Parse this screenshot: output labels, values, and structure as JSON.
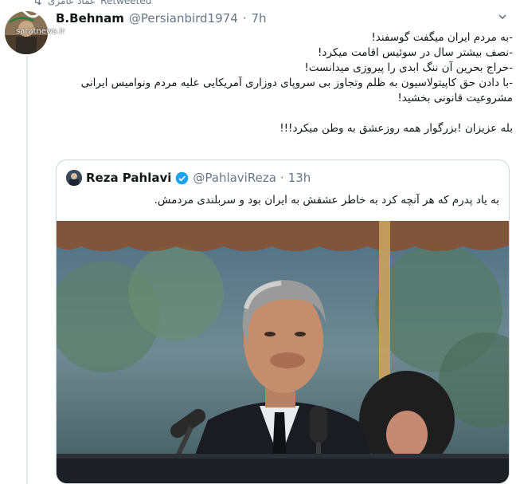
{
  "retweet": {
    "retweeter": "عماد عامری",
    "label": "Retweeted",
    "icon": "retweet-icon"
  },
  "watermark": {
    "site": "saratnews.ir"
  },
  "tweet": {
    "display_name": "B.Behnam",
    "handle": "@Persianbird1974",
    "dot": "·",
    "time": "7h",
    "lines": [
      "-به مردم ایران میگفت گوسفند!",
      "-نصف بیشتر سال در سوئیس اقامت میکرد!",
      "-حراج بحرین آن ننگ ابدی را پیروزی میدانست!",
      "-با دادن حق کاپیتولاسیون به ظلم وتجاوز بی سروپای دوزاری آمریکایی علیه مردم ونوامیس ایرانی",
      "مشروعیت قانونی بخشید!"
    ],
    "closing": "بله عزیزان !بزرگوار همه روزعشق به وطن میکرد!!!"
  },
  "quote": {
    "display_name": "Reza Pahlavi",
    "handle": "@PahlaviReza",
    "dot": "·",
    "time": "13h",
    "text": "به یاد پدرم که هر آنچه کرد به خاطر عشقش به ایران بود و سربلندی مردمش."
  },
  "colors": {
    "verified": "#1da1f2",
    "muted": "#657786",
    "border": "#ccd6dd"
  }
}
